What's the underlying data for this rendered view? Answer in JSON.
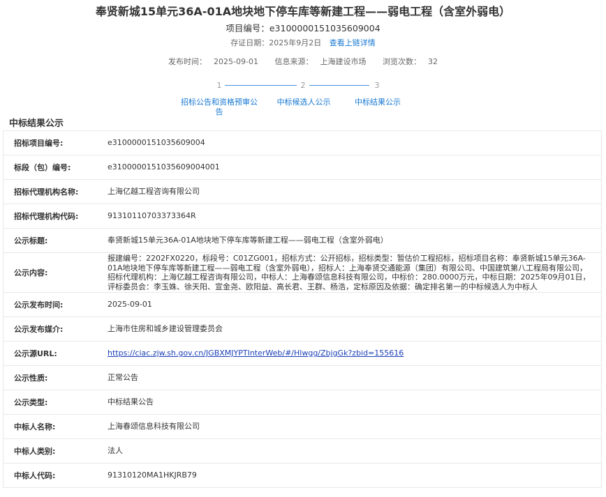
{
  "header": {
    "title": "奉贤新城15单元36A-01A地块地下停车库等新建工程——弱电工程（含室外弱电）",
    "project_no_label": "项目编号：",
    "project_no": "e3100000151035609004",
    "cert_date_label": "存证日期：",
    "cert_date": "2025年9月2日",
    "chain_link": "查看上链详情",
    "publish_time_label": "发布时间：",
    "publish_time": "2025-09-01",
    "source_label": "信息来源：",
    "source": "上海建设市场",
    "views_label": "浏览次数：",
    "views": "32"
  },
  "steps": [
    {
      "num": "1",
      "label": "招标公告和资格预审公告"
    },
    {
      "num": "2",
      "label": "中标候选人公示"
    },
    {
      "num": "3",
      "label": "中标结果公示"
    }
  ],
  "section": {
    "heading": "中标结果公示"
  },
  "rows": [
    {
      "label": "招标项目编号:",
      "value": "e3100000151035609004"
    },
    {
      "label": "标段（包）编号:",
      "value": "e3100000151035609004001"
    },
    {
      "label": "招标代理机构名称:",
      "value": "上海亿越工程咨询有限公司"
    },
    {
      "label": "招标代理机构代码:",
      "value": "91310110703373364R"
    },
    {
      "label": "公示标题:",
      "value": "奉贤新城15单元36A-01A地块地下停车库等新建工程——弱电工程（含室外弱电）"
    },
    {
      "label": "公示内容:",
      "value": "报建编号：2202FX0220，标段号：C01ZG001，招标方式：公开招标，招标类型：暂估价工程招标，招标项目名称：奉贤新城15单元36A-01A地块地下停车库等新建工程——弱电工程（含室外弱电），招标人：上海奉贤交通能源（集团）有限公司、中国建筑第八工程局有限公司，招标代理机构：上海亿越工程咨询有限公司，中标人：上海春颂信息科技有限公司，中标价：280.0000万元，中标日期：2025年09月01日，评标委员会：李玉姝、徐天阳、宣金尧、欧阳益、高长君、王群、杨浩，定标原因及依据：确定排名第一的中标候选人为中标人"
    },
    {
      "label": "公示发布时间:",
      "value": "2025-09-01"
    },
    {
      "label": "公示发布媒介:",
      "value": "上海市住房和城乡建设管理委员会"
    },
    {
      "label": "公示源URL:",
      "value": "https://ciac.zjw.sh.gov.cn/JGBXMJYPTInterWeb/#/Hlwgg/ZbjgGk?zbid=155616"
    },
    {
      "label": "公示性质:",
      "value": "正常公告"
    },
    {
      "label": "公示类型:",
      "value": "中标结果公告"
    },
    {
      "label": "中标人名称:",
      "value": "上海春颂信息科技有限公司"
    },
    {
      "label": "中标人类别:",
      "value": "法人"
    },
    {
      "label": "中标人代码:",
      "value": "91310120MA1HKJRB79"
    }
  ]
}
